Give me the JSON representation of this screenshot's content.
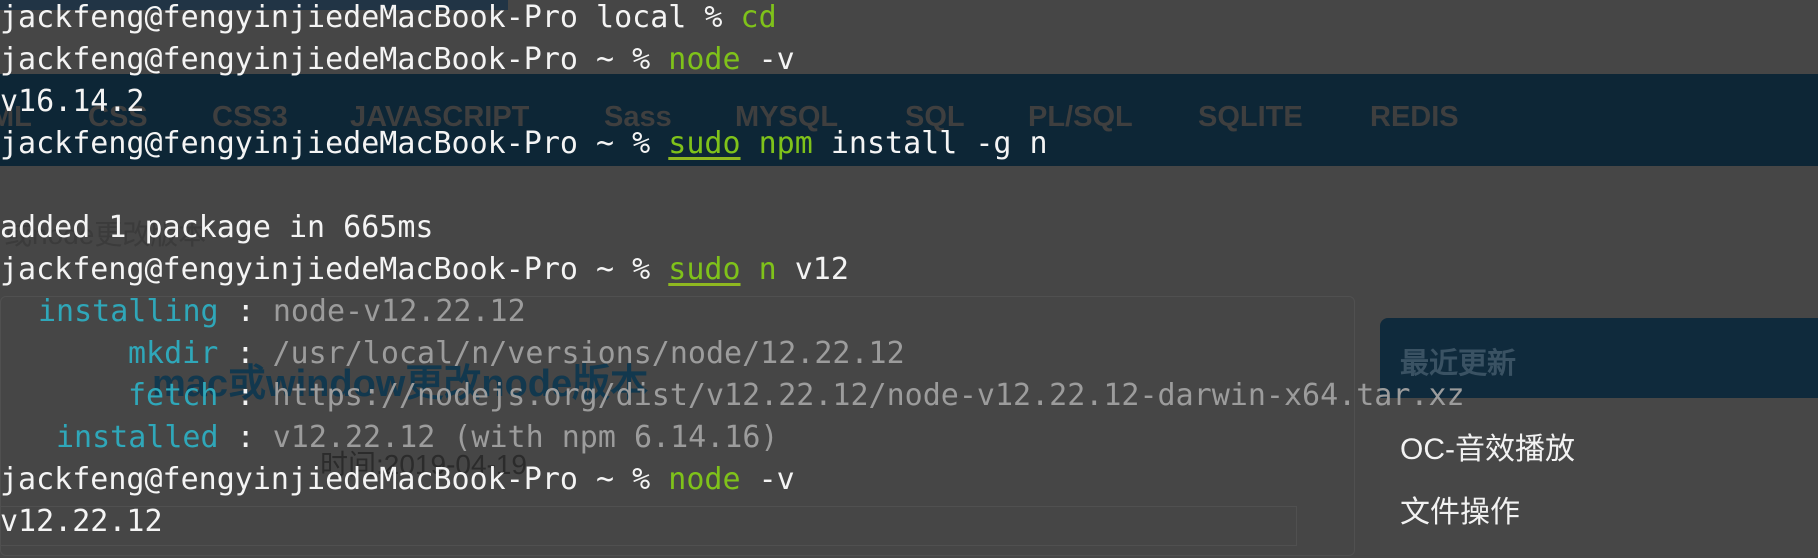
{
  "background_page": {
    "nav_items": [
      "ML",
      "CSS",
      "CSS3",
      "JAVASCRIPT",
      "Sass",
      "MYSQL",
      "SQL",
      "PL/SQL",
      "SQLITE",
      "REDIS"
    ],
    "partial_text": "或node更改版本",
    "article_title": "mac或window更改node版本",
    "article_time": "时间:2019-04-19",
    "sidebar_title": "最近更新",
    "sidebar_links": [
      "OC-音效播放",
      "文件操作"
    ]
  },
  "terminal": {
    "prompt_user": "jackfeng@fengyinjiedeMacBook-Pro",
    "lines": {
      "l1": {
        "dir": "local",
        "cmd": "cd"
      },
      "l2": {
        "dir": "~",
        "cmd": "node",
        "args": "-v"
      },
      "l3": {
        "out": "v16.14.2"
      },
      "l4": {
        "dir": "~",
        "sudo": "sudo",
        "cmd": "npm",
        "args": "install -g n"
      },
      "l5": {
        "out": "added 1 package in 665ms"
      },
      "l6": {
        "dir": "~",
        "sudo": "sudo",
        "cmd": "n",
        "args": "v12"
      },
      "l7": {
        "label": "installing",
        "value": "node-v12.22.12"
      },
      "l8": {
        "label": "mkdir",
        "value": "/usr/local/n/versions/node/12.22.12"
      },
      "l9": {
        "label": "fetch",
        "value": "https://nodejs.org/dist/v12.22.12/node-v12.22.12-darwin-x64.tar.xz"
      },
      "l10": {
        "label": "installed",
        "value": "v12.22.12 (with npm 6.14.16)"
      },
      "l11": {
        "dir": "~",
        "cmd": "node",
        "args": "-v"
      },
      "l12": {
        "out": "v12.22.12"
      }
    },
    "prompt_symbol": "%",
    "separator": ":"
  },
  "colors": {
    "command_green": "#7fc21a",
    "label_cyan": "#2fa7b9",
    "output_gray": "#9c9c9c",
    "text_white": "#f4f4f4"
  }
}
